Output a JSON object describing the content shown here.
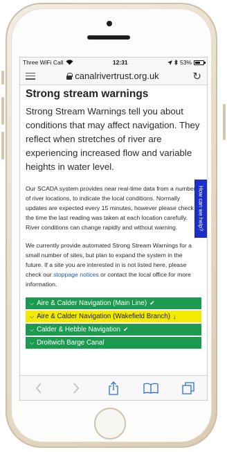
{
  "status_bar": {
    "carrier": "Three WiFi Call",
    "time": "12:31",
    "battery": "53%"
  },
  "browser": {
    "url": "canalrivertrust.org.uk"
  },
  "page": {
    "title": "Strong stream warnings",
    "lead": "Strong Stream Warnings tell you about conditions that may affect navigation. They reflect when stretches of river are experiencing increased flow and variable heights in water level.",
    "para1": "Our SCADA system provides near real-time data from a number of river locations, to indicate the local conditions. Normally updates are expected every 15 minutes, however please check the time the last reading was taken at each location carefully. River conditions can change rapidly and without warning.",
    "para2_part1": "We currently provide automated Strong Stream Warnings for a small number of sites, but plan to expand the system in the future. If a site you are interested in is not listed here, please check our ",
    "para2_link": "stoppage notices",
    "para2_part2": " or contact the local office for more information."
  },
  "waterways": [
    {
      "label": "Aire & Calder Navigation (Main Line)",
      "status": "ok"
    },
    {
      "label": "Aire & Calder Navigation (Wakefield Branch)",
      "status": "warning"
    },
    {
      "label": "Calder & Hebble Navigation",
      "status": "ok"
    },
    {
      "label": "Droitwich Barge Canal",
      "status": "ok"
    }
  ],
  "help_tab": "How can we help?",
  "colors": {
    "ok": "#1c9a4f",
    "warning": "#f4ea00",
    "help": "#1b2fc8",
    "link": "#1d5ea8"
  },
  "icons": {
    "ok": "check-circle-icon",
    "warning": "arrow-down-icon"
  }
}
